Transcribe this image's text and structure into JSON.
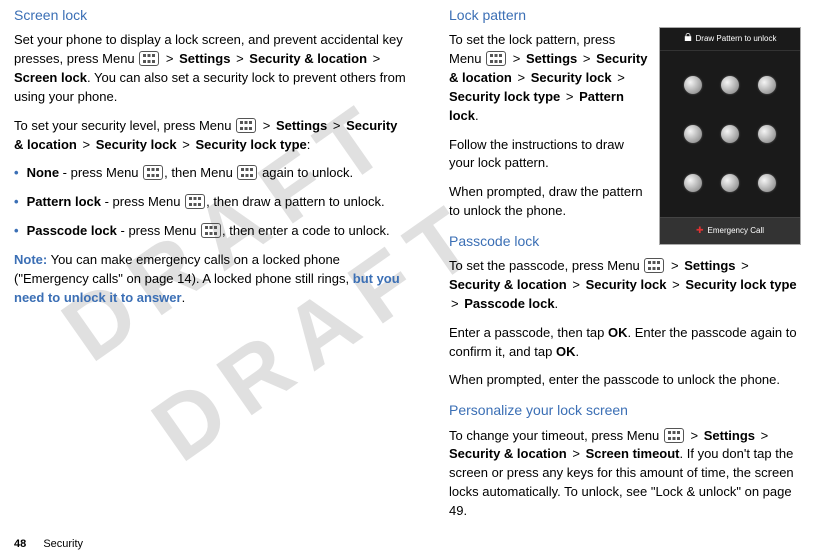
{
  "watermark": "DRAFT",
  "left": {
    "h_screen_lock": "Screen lock",
    "p1_a": "Set your phone to display a lock screen, and prevent accidental key presses, press Menu",
    "p1_b": "Settings",
    "p1_c": "Security & location",
    "p1_d": "Screen lock",
    "p1_e": ". You can also set a security lock to prevent others from using your phone.",
    "p2_a": "To set your security level, press Menu",
    "p2_b": "Settings",
    "p2_c": "Security & location",
    "p2_d": "Security lock",
    "p2_e": "Security lock type",
    "p2_f": ":",
    "b1_bold": "None",
    "b1_a": " - press Menu",
    "b1_b": ", then Menu",
    "b1_c": " again to unlock.",
    "b2_bold": "Pattern lock",
    "b2_a": " - press Menu",
    "b2_b": ", then draw a pattern to unlock.",
    "b3_bold": "Passcode lock",
    "b3_a": " - press Menu",
    "b3_b": ", then enter a code to unlock.",
    "note_label": "Note:",
    "note_a": " You can make emergency calls on a locked phone (\"Emergency calls\" on page 14). A locked phone still rings, ",
    "note_link": "but you need to unlock it to answer",
    "note_end": "."
  },
  "right": {
    "h_lock_pattern": "Lock pattern",
    "lp1_a": "To set the lock pattern, press Menu",
    "lp1_b": "Settings",
    "lp1_c": "Security & location",
    "lp1_d": "Security lock",
    "lp1_e": "Security lock type",
    "lp1_f": "Pattern lock",
    "lp1_g": ".",
    "lp2": "Follow the instructions to draw your lock pattern.",
    "lp3": "When prompted, draw the pattern to unlock the phone.",
    "h_passcode": "Passcode lock",
    "pc1_a": "To set the passcode, press Menu",
    "pc1_b": "Settings",
    "pc1_c": "Security & location",
    "pc1_d": "Security lock",
    "pc1_e": "Security lock type",
    "pc1_f": "Passcode lock",
    "pc1_g": ".",
    "pc2_a": "Enter a passcode, then tap ",
    "pc2_ok1": "OK",
    "pc2_b": ". Enter the passcode again to confirm it, and tap ",
    "pc2_ok2": "OK",
    "pc2_c": ".",
    "pc3": "When prompted, enter the passcode to unlock the phone.",
    "h_personalize": "Personalize your lock screen",
    "pl1_a": "To change your timeout, press Menu",
    "pl1_b": "Settings",
    "pl1_c": "Security & location",
    "pl1_d": "Screen timeout",
    "pl1_e": ". If you don't tap the screen or press any keys for this amount of time, the screen locks automatically. To unlock, see \"Lock & unlock\" on page 49."
  },
  "phone": {
    "header": "Draw Pattern to unlock",
    "footer": "Emergency Call"
  },
  "footer": {
    "page": "48",
    "section": "Security"
  },
  "gt": ">"
}
